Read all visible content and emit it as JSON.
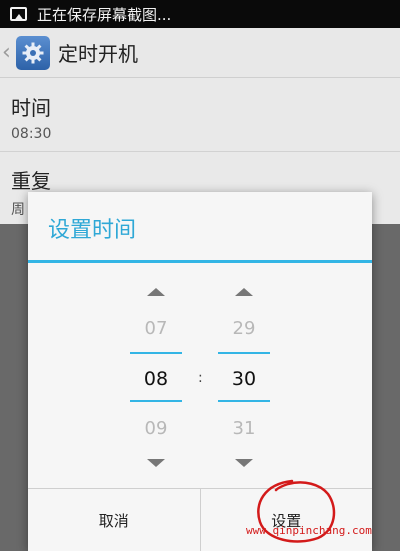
{
  "status_bar": {
    "notification": "正在保存屏幕截图...",
    "icon": "image-icon"
  },
  "action_bar": {
    "back_icon": "chevron-left-icon",
    "app_icon": "gear-icon",
    "title": "定时开机"
  },
  "settings": {
    "time": {
      "label": "时间",
      "value": "08:30"
    },
    "repeat": {
      "label": "重复",
      "value_partial": "周"
    }
  },
  "dialog": {
    "title": "设置时间",
    "hour": {
      "prev": "07",
      "current": "08",
      "next": "09"
    },
    "minute": {
      "prev": "29",
      "current": "30",
      "next": "31"
    },
    "separator": ":",
    "cancel_label": "取消",
    "set_label": "设置"
  },
  "watermark": "www.qinpinchang.com",
  "colors": {
    "accent": "#33b5e5",
    "annotation": "#d31a1a"
  }
}
